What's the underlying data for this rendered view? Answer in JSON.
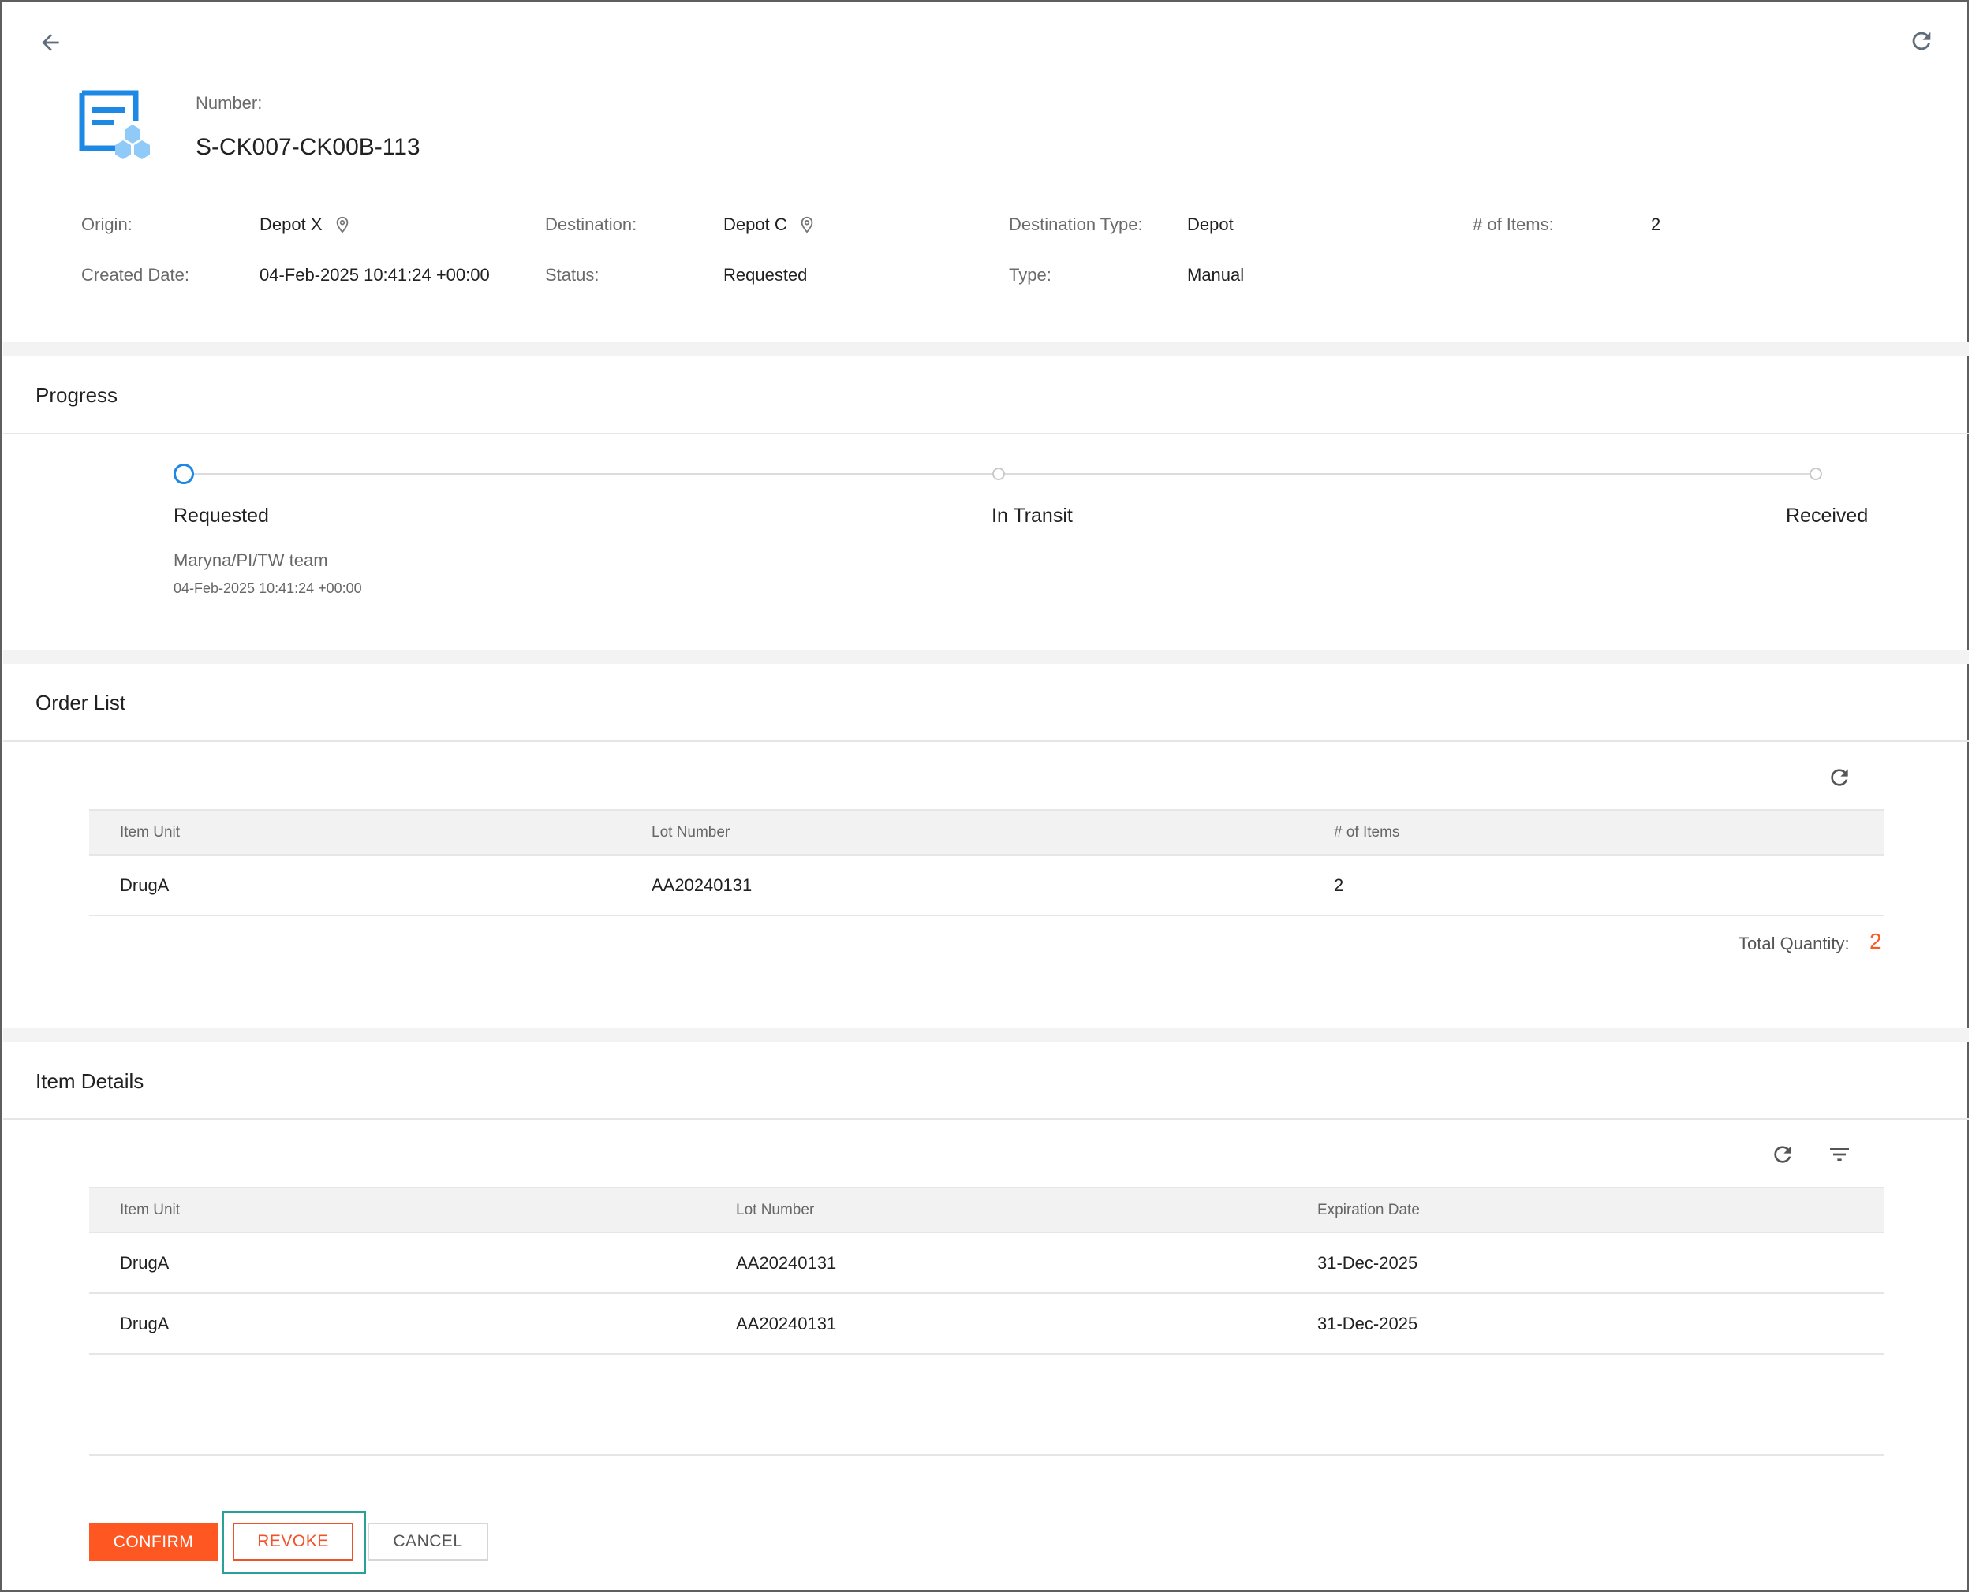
{
  "header": {
    "back_icon": "arrow-left-icon",
    "refresh_icon": "refresh-icon",
    "number_label": "Number:",
    "number_value": "S-CK007-CK00B-113",
    "fields": {
      "origin_label": "Origin:",
      "origin_value": "Depot X",
      "destination_label": "Destination:",
      "destination_value": "Depot C",
      "destination_type_label": "Destination Type:",
      "destination_type_value": "Depot",
      "items_label": "# of Items:",
      "items_value": "2",
      "created_date_label": "Created Date:",
      "created_date_value": "04-Feb-2025 10:41:24 +00:00",
      "status_label": "Status:",
      "status_value": "Requested",
      "type_label": "Type:",
      "type_value": "Manual"
    }
  },
  "progress": {
    "title": "Progress",
    "steps": [
      {
        "label": "Requested",
        "active": true,
        "by": "Maryna/PI/TW team",
        "date": "04-Feb-2025 10:41:24 +00:00"
      },
      {
        "label": "In Transit",
        "active": false
      },
      {
        "label": "Received",
        "active": false
      }
    ]
  },
  "order_list": {
    "title": "Order List",
    "columns": [
      "Item Unit",
      "Lot Number",
      "# of Items"
    ],
    "rows": [
      [
        "DrugA",
        "AA20240131",
        "2"
      ]
    ],
    "total_label": "Total Quantity:",
    "total_value": "2"
  },
  "item_details": {
    "title": "Item Details",
    "columns": [
      "Item Unit",
      "Lot Number",
      "Expiration Date"
    ],
    "rows": [
      [
        "DrugA",
        "AA20240131",
        "31-Dec-2025"
      ],
      [
        "DrugA",
        "AA20240131",
        "31-Dec-2025"
      ]
    ]
  },
  "actions": {
    "confirm": "CONFIRM",
    "revoke": "REVOKE",
    "cancel": "CANCEL"
  },
  "colors": {
    "accent_orange": "#ff5722",
    "progress_blue": "#1e88e5",
    "focus_teal": "#2aa198"
  }
}
